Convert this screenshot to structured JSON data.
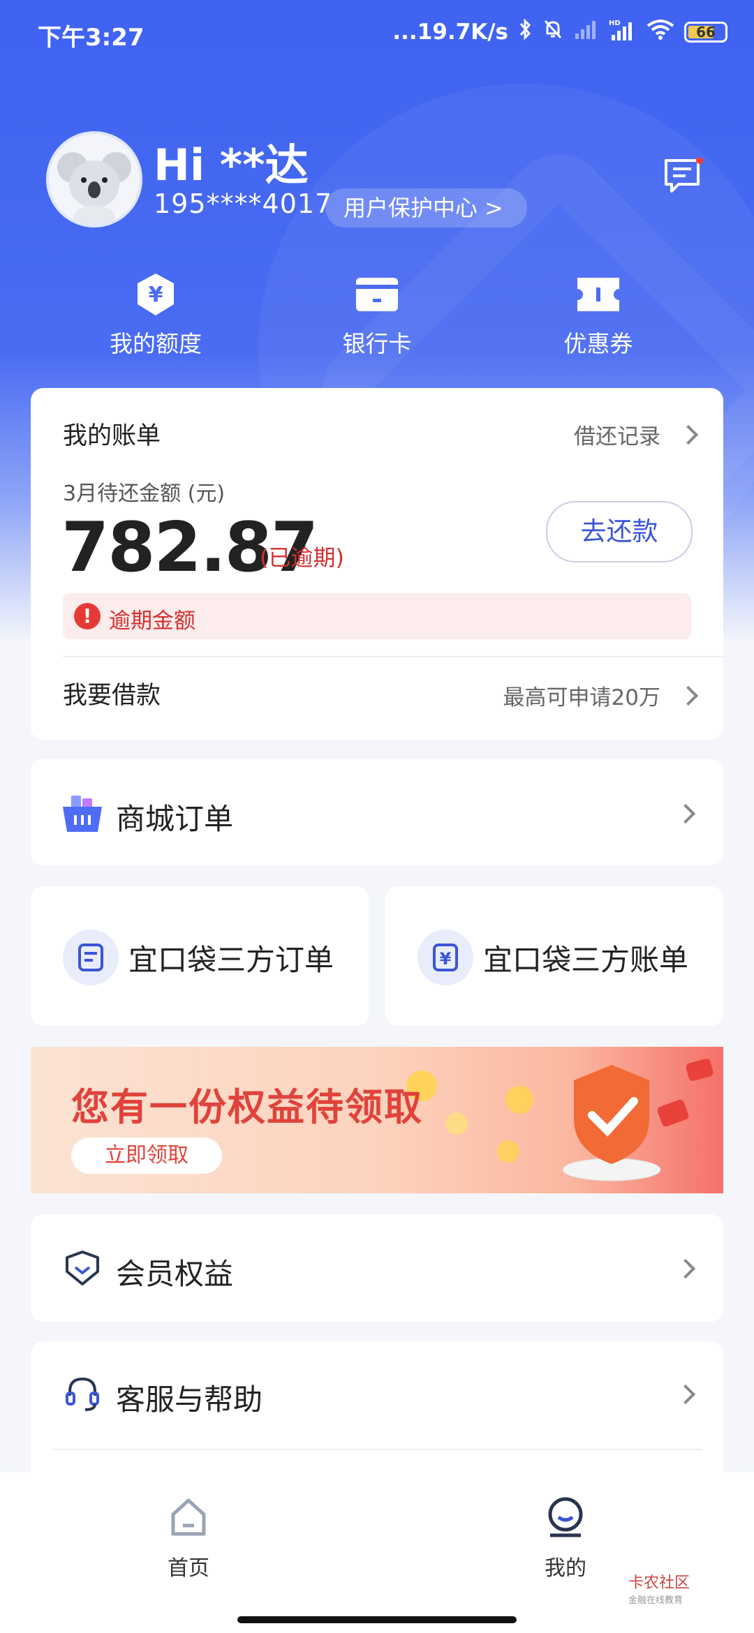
{
  "status_bar": {
    "time": "下午3:27",
    "speed": "...19.7K/s",
    "battery": "66"
  },
  "profile": {
    "greeting": "Hi **达",
    "phone": "195****4017",
    "protect_center": "用户保护中心 >"
  },
  "quick_actions": [
    {
      "label": "我的额度",
      "icon": "yuan-shield-icon"
    },
    {
      "label": "银行卡",
      "icon": "bank-card-icon"
    },
    {
      "label": "优惠券",
      "icon": "coupon-icon"
    }
  ],
  "bill": {
    "title": "我的账单",
    "history_link": "借还记录",
    "due_label": "3月待还金额 (元)",
    "amount": "782.87",
    "overdue_tag": "(已逾期)",
    "repay_button": "去还款",
    "overdue_notice": "逾期金额",
    "borrow_title": "我要借款",
    "borrow_hint": "最高可申请20万"
  },
  "mall": {
    "title": "商城订单"
  },
  "third_party": {
    "orders": "宜口袋三方订单",
    "bills": "宜口袋三方账单"
  },
  "banner": {
    "title": "您有一份权益待领取",
    "button": "立即领取"
  },
  "member": {
    "title": "会员权益"
  },
  "service": {
    "title": "客服与帮助"
  },
  "tabs": [
    {
      "label": "首页",
      "icon": "home-icon"
    },
    {
      "label": "我的",
      "icon": "profile-icon"
    }
  ],
  "watermark": {
    "name": "卡农社区",
    "sub": "金融在线教育"
  },
  "colors": {
    "primary": "#4a6cf2",
    "danger": "#e53935",
    "accent_text": "#3a55d8"
  }
}
